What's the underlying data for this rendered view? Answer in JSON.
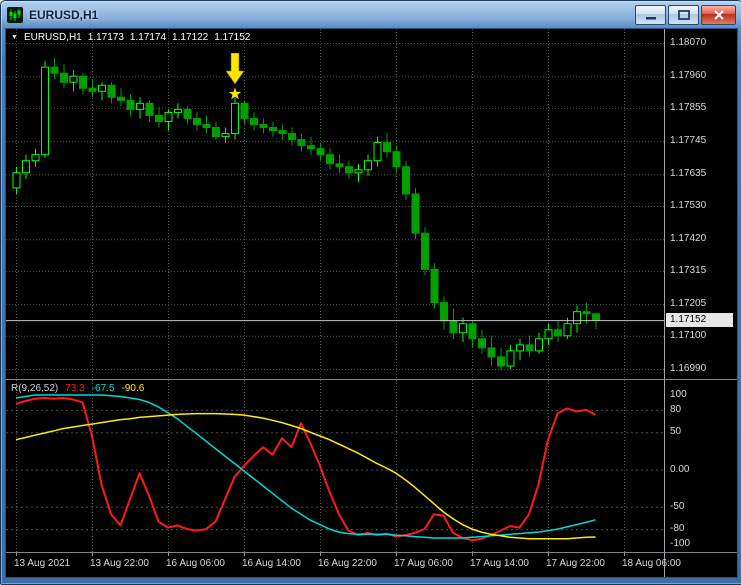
{
  "window": {
    "title": "EURUSD,H1",
    "controls": [
      "minimize",
      "maximize",
      "close"
    ]
  },
  "chart": {
    "header": {
      "dropdown_icon": "down-triangle",
      "symbol": "EURUSD,H1",
      "open": "1.17173",
      "high": "1.17174",
      "low": "1.17122",
      "close": "1.17152"
    },
    "price_axis": {
      "current": "1.17152"
    },
    "marker": {
      "type": "down-arrow-with-star",
      "candle_index": 23
    }
  },
  "indicator": {
    "name": "R(9,26,52)",
    "values": [
      "73.3",
      "-67.5",
      "-90.6"
    ]
  },
  "colors": {
    "chart_background": "#000000",
    "grid": "#3f5a3f",
    "bull_candle": "#00ff00",
    "bear_candle": "#009f00",
    "price_line": "#c8c8c8",
    "current_price_badge_bg": "#e6e6e6",
    "axis_text": "#d8d8d8",
    "indicator_red": "#ff1a1a",
    "indicator_cyan": "#00d8d8",
    "indicator_yellow": "#ffec00",
    "marker_yellow": "#ffe400",
    "titlebar_blue": "#5d8cc4"
  },
  "chart_data": [
    {
      "type": "candlestick",
      "title": "EURUSD,H1",
      "price_ticks": [
        1.1807,
        1.1796,
        1.17855,
        1.17745,
        1.17635,
        1.1753,
        1.1742,
        1.17315,
        1.17205,
        1.171,
        1.1699
      ],
      "current_price": 1.17152,
      "time_labels": [
        {
          "index": 0,
          "label": "13 Aug 2021"
        },
        {
          "index": 8,
          "label": "13 Aug 22:00"
        },
        {
          "index": 16,
          "label": "16 Aug 06:00"
        },
        {
          "index": 24,
          "label": "16 Aug 14:00"
        },
        {
          "index": 32,
          "label": "16 Aug 22:00"
        },
        {
          "index": 40,
          "label": "17 Aug 06:00"
        },
        {
          "index": 48,
          "label": "17 Aug 14:00"
        },
        {
          "index": 56,
          "label": "17 Aug 22:00"
        },
        {
          "index": 64,
          "label": "18 Aug 06:00"
        }
      ],
      "ohlc": [
        [
          1.1759,
          1.1766,
          1.1757,
          1.1764
        ],
        [
          1.1764,
          1.177,
          1.1762,
          1.1768
        ],
        [
          1.1768,
          1.1772,
          1.1766,
          1.177
        ],
        [
          1.177,
          1.1801,
          1.1769,
          1.1799
        ],
        [
          1.1799,
          1.1802,
          1.1795,
          1.1797
        ],
        [
          1.1797,
          1.18,
          1.1792,
          1.1794
        ],
        [
          1.1794,
          1.1798,
          1.1791,
          1.1796
        ],
        [
          1.1796,
          1.1797,
          1.179,
          1.1792
        ],
        [
          1.1792,
          1.1795,
          1.1789,
          1.1791
        ],
        [
          1.1791,
          1.1794,
          1.1788,
          1.1793
        ],
        [
          1.1793,
          1.1794,
          1.1787,
          1.1789
        ],
        [
          1.1789,
          1.1792,
          1.1786,
          1.1788
        ],
        [
          1.1788,
          1.179,
          1.1783,
          1.1785
        ],
        [
          1.1785,
          1.1789,
          1.1782,
          1.1787
        ],
        [
          1.1787,
          1.1788,
          1.1781,
          1.1783
        ],
        [
          1.1783,
          1.1786,
          1.1779,
          1.1781
        ],
        [
          1.1781,
          1.1785,
          1.1778,
          1.1784
        ],
        [
          1.1784,
          1.1787,
          1.1782,
          1.1785
        ],
        [
          1.1785,
          1.1786,
          1.178,
          1.1782
        ],
        [
          1.1782,
          1.1784,
          1.1778,
          1.178
        ],
        [
          1.178,
          1.1783,
          1.1777,
          1.1779
        ],
        [
          1.1779,
          1.1781,
          1.1775,
          1.1776
        ],
        [
          1.1776,
          1.1779,
          1.1774,
          1.1777
        ],
        [
          1.1777,
          1.1789,
          1.1775,
          1.1787
        ],
        [
          1.1787,
          1.1788,
          1.178,
          1.1782
        ],
        [
          1.1782,
          1.1784,
          1.1778,
          1.178
        ],
        [
          1.178,
          1.1782,
          1.1777,
          1.1779
        ],
        [
          1.1779,
          1.1781,
          1.1776,
          1.1778
        ],
        [
          1.1778,
          1.178,
          1.1775,
          1.1777
        ],
        [
          1.1777,
          1.1779,
          1.1773,
          1.1775
        ],
        [
          1.1775,
          1.1777,
          1.1771,
          1.1773
        ],
        [
          1.1773,
          1.1776,
          1.177,
          1.1772
        ],
        [
          1.1772,
          1.1774,
          1.1768,
          1.177
        ],
        [
          1.177,
          1.1772,
          1.1765,
          1.1767
        ],
        [
          1.1767,
          1.177,
          1.1764,
          1.1766
        ],
        [
          1.1766,
          1.1768,
          1.1762,
          1.1764
        ],
        [
          1.1764,
          1.1767,
          1.1761,
          1.1765
        ],
        [
          1.1765,
          1.177,
          1.1763,
          1.1768
        ],
        [
          1.1768,
          1.1776,
          1.1766,
          1.1774
        ],
        [
          1.1774,
          1.1777,
          1.1769,
          1.1771
        ],
        [
          1.1771,
          1.1773,
          1.1764,
          1.1766
        ],
        [
          1.1766,
          1.1768,
          1.1755,
          1.1757
        ],
        [
          1.1757,
          1.1759,
          1.1742,
          1.1744
        ],
        [
          1.1744,
          1.1746,
          1.173,
          1.1732
        ],
        [
          1.1732,
          1.1734,
          1.1719,
          1.1721
        ],
        [
          1.1721,
          1.1723,
          1.1712,
          1.1715
        ],
        [
          1.1715,
          1.1719,
          1.1709,
          1.1711
        ],
        [
          1.1711,
          1.1716,
          1.1708,
          1.1714
        ],
        [
          1.1714,
          1.1715,
          1.1706,
          1.1709
        ],
        [
          1.1709,
          1.1712,
          1.1704,
          1.1706
        ],
        [
          1.1706,
          1.171,
          1.17,
          1.1703
        ],
        [
          1.1703,
          1.1706,
          1.16985,
          1.17
        ],
        [
          1.17,
          1.1707,
          1.1699,
          1.1705
        ],
        [
          1.1705,
          1.1709,
          1.1702,
          1.1707
        ],
        [
          1.1707,
          1.171,
          1.1703,
          1.1705
        ],
        [
          1.1705,
          1.1711,
          1.1704,
          1.1709
        ],
        [
          1.1709,
          1.1714,
          1.1707,
          1.1712
        ],
        [
          1.1712,
          1.1715,
          1.1708,
          1.171
        ],
        [
          1.171,
          1.1716,
          1.1709,
          1.1714
        ],
        [
          1.1714,
          1.172,
          1.1711,
          1.1718
        ],
        [
          1.1718,
          1.1721,
          1.1714,
          1.17173
        ],
        [
          1.17173,
          1.17174,
          1.17122,
          1.17152
        ]
      ]
    },
    {
      "type": "line",
      "title": "R(9,26,52)",
      "current_values": [
        73.3,
        -67.5,
        -90.6
      ],
      "ylim": [
        -100,
        100
      ],
      "axis_ticks": [
        {
          "value": 100,
          "label": "100"
        },
        {
          "value": 80,
          "label": "80"
        },
        {
          "value": 50,
          "label": "50"
        },
        {
          "value": 0,
          "label": "0.00"
        },
        {
          "value": -50,
          "label": "-50"
        },
        {
          "value": -80,
          "label": "-80"
        },
        {
          "value": -100,
          "label": "-100"
        }
      ],
      "level_lines": [
        80,
        50,
        0,
        -50,
        -80
      ],
      "series": [
        {
          "name": "R-fast",
          "color": "#ff1a1a",
          "width": 2,
          "values": [
            88,
            92,
            95,
            96,
            95,
            96,
            94,
            90,
            45,
            -20,
            -60,
            -75,
            -40,
            -5,
            -35,
            -70,
            -78,
            -75,
            -80,
            -82,
            -80,
            -70,
            -40,
            -10,
            5,
            18,
            30,
            20,
            42,
            30,
            62,
            35,
            5,
            -30,
            -60,
            -82,
            -88,
            -85,
            -88,
            -86,
            -90,
            -88,
            -85,
            -80,
            -60,
            -62,
            -85,
            -92,
            -95,
            -93,
            -88,
            -82,
            -76,
            -78,
            -60,
            -20,
            40,
            75,
            82,
            78,
            80,
            73.3
          ]
        },
        {
          "name": "R-mid",
          "color": "#00d8d8",
          "width": 1.5,
          "values": [
            96,
            98,
            100,
            100,
            100,
            100,
            100,
            100,
            100,
            100,
            99,
            98,
            96,
            94,
            90,
            84,
            76,
            68,
            58,
            48,
            38,
            28,
            18,
            8,
            -2,
            -12,
            -22,
            -32,
            -42,
            -52,
            -60,
            -68,
            -74,
            -80,
            -84,
            -86,
            -87,
            -87,
            -87,
            -87,
            -88,
            -89,
            -90,
            -91,
            -92,
            -92,
            -92,
            -92,
            -91,
            -90,
            -89,
            -88,
            -87,
            -86,
            -85,
            -84,
            -82,
            -80,
            -77,
            -74,
            -71,
            -67.5
          ]
        },
        {
          "name": "R-slow",
          "color": "#ffec00",
          "width": 1.5,
          "values": [
            40,
            43,
            46,
            49,
            52,
            55,
            57,
            59,
            61,
            63,
            65,
            67,
            68,
            70,
            71,
            72,
            73,
            74,
            74.5,
            75,
            75,
            75,
            74.5,
            74,
            73,
            71,
            69,
            66,
            63,
            59,
            55,
            50,
            45,
            40,
            34,
            28,
            22,
            15,
            8,
            2,
            -5,
            -14,
            -24,
            -35,
            -46,
            -57,
            -66,
            -74,
            -80,
            -84,
            -87,
            -89,
            -91,
            -92,
            -93,
            -93,
            -93,
            -93,
            -93,
            -92,
            -91,
            -90.6
          ]
        }
      ]
    }
  ]
}
